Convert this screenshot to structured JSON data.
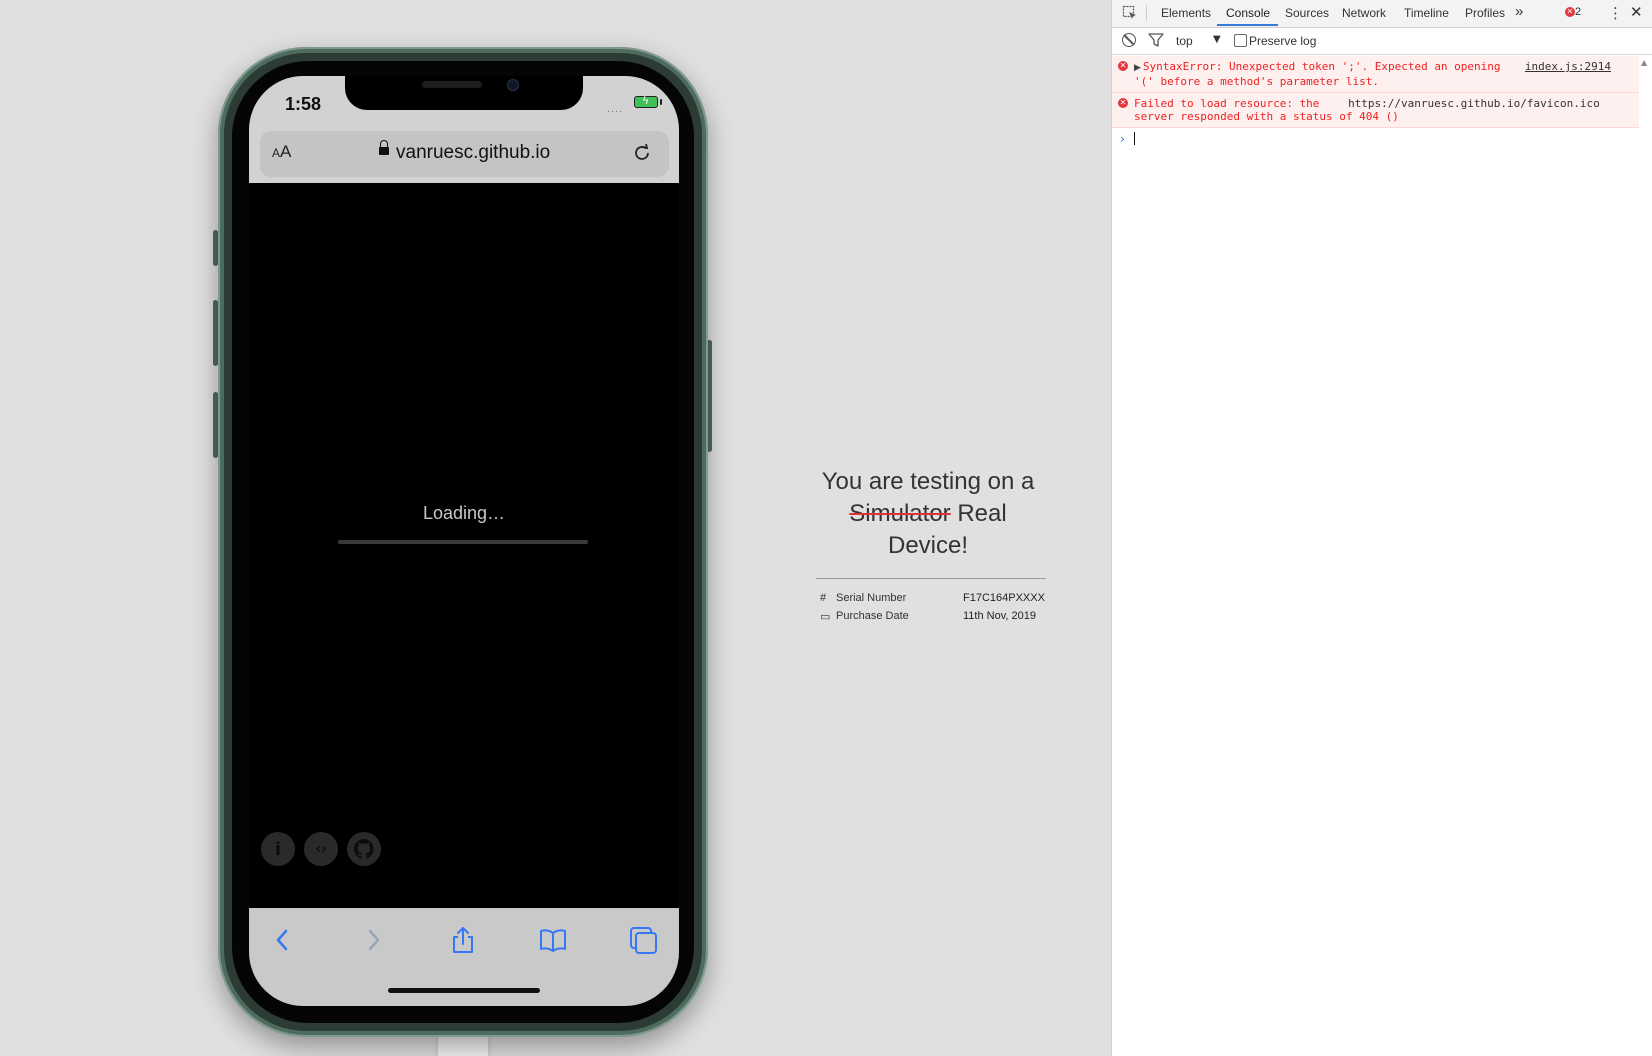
{
  "phone": {
    "time": "1:58",
    "signal": "....",
    "aa_label_small": "A",
    "aa_label": "A",
    "url": "vanruesc.github.io",
    "loading_text": "Loading…",
    "loading_progress": 0
  },
  "info": {
    "headline_line1": "You are testing on a",
    "struck_word": "Simulator",
    "replacement": "Real Device!",
    "specs": [
      {
        "icon": "#",
        "label": "Serial Number",
        "value": "F17C164PXXXX"
      },
      {
        "icon": "▭",
        "label": "Purchase Date",
        "value": "11th Nov, 2019"
      }
    ]
  },
  "devtools": {
    "tabs": [
      "Elements",
      "Console",
      "Sources",
      "Network",
      "Timeline",
      "Profiles"
    ],
    "active_tab": "Console",
    "more_tabs": "»",
    "error_count": "2",
    "menu": "⋮",
    "close": "✕",
    "context": "top",
    "context_arrow": "▼",
    "preserve_log": "Preserve log",
    "messages": [
      {
        "line1": "SyntaxError: Unexpected token ';'. Expected an opening",
        "line2": "'(' before a method's parameter list.",
        "source": "index.js:2914"
      },
      {
        "line1_prefix": "Failed to load resource: the",
        "url": "https://vanruesc.github.io/favicon.ico",
        "line2": "server responded with a status of 404 ()"
      }
    ],
    "prompt_caret": "›",
    "error_glyph": "✕",
    "expand_glyph": "▶"
  },
  "colors": {
    "phone_frame": "#4d6c5f",
    "ios_blue": "#3478f6",
    "error_red": "#e0383e",
    "strike_red": "#dd3333",
    "devtools_accent": "#3879d9"
  }
}
